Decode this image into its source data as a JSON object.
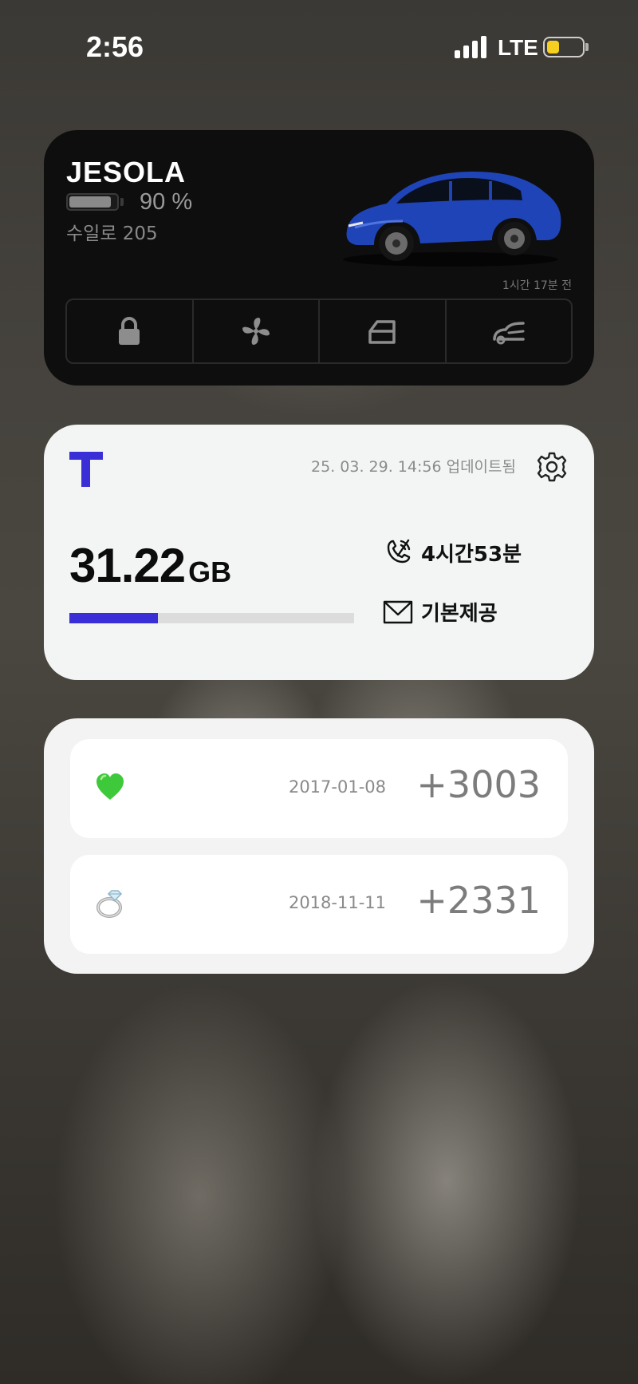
{
  "status_bar": {
    "time": "2:56",
    "network": "LTE",
    "battery_level": 0.35,
    "battery_color": "#f5d020"
  },
  "tesla": {
    "name": "JESOLA",
    "battery_percent": 90,
    "battery_label": "90 %",
    "range": "수일로 205",
    "updated": "1시간 17분 전",
    "car_color": "#1f44b8",
    "controls": [
      "lock-icon",
      "fan-icon",
      "frunk-icon",
      "trunk-icon"
    ]
  },
  "tworld": {
    "updated": "25. 03. 29. 14:56 업데이트됨",
    "data_amount": "31.22",
    "data_unit": "GB",
    "data_used_fraction": 0.31,
    "voice": "4시간53분",
    "sms": "기본제공",
    "brand_color": "#3a2fd6"
  },
  "dday": {
    "items": [
      {
        "icon": "green-heart-icon",
        "date": "2017-01-08",
        "count": "+3003"
      },
      {
        "icon": "ring-icon",
        "date": "2018-11-11",
        "count": "+2331"
      }
    ]
  }
}
